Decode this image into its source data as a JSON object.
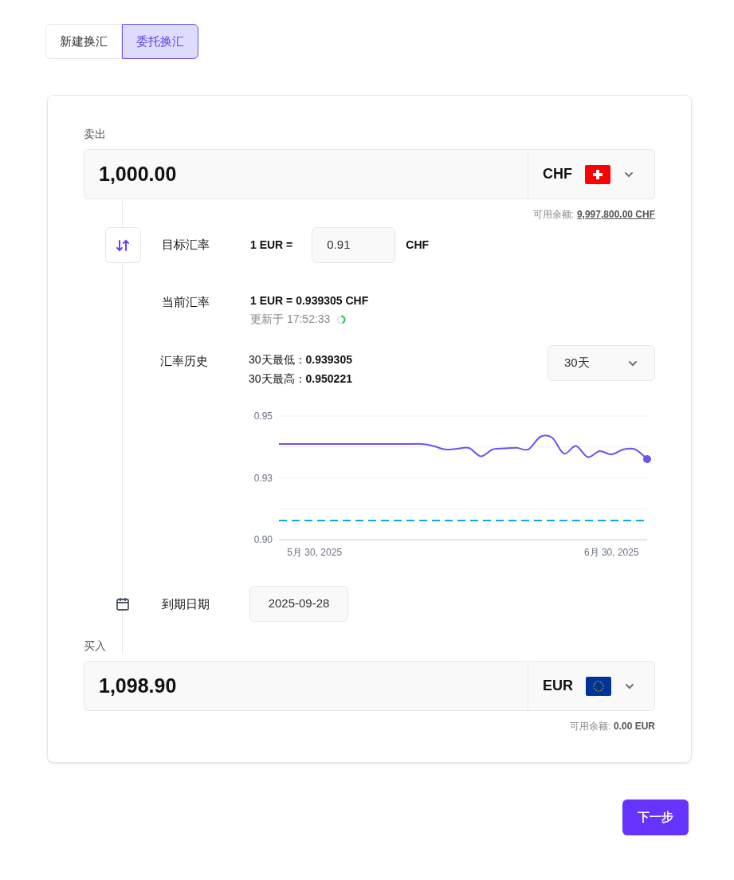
{
  "tabs": [
    {
      "label": "新建换汇",
      "selected": false
    },
    {
      "label": "委托换汇",
      "selected": true
    }
  ],
  "sell": {
    "label": "卖出",
    "amount": "1,000.00",
    "currency": "CHF",
    "kind": "ch",
    "balance_label": "可用余额:",
    "balance": "9,997,800.00 CHF",
    "balance_link": true
  },
  "target_rate": {
    "label": "目标汇率",
    "prefix": "1 EUR =",
    "value": "0.91",
    "suffix": "CHF"
  },
  "current_rate": {
    "label": "当前汇率",
    "rate": "1 EUR = 0.939305 CHF",
    "updated": "更新于 17:52:33"
  },
  "history": {
    "label": "汇率历史",
    "low_label": "30天最低：",
    "low": "0.939305",
    "high_label": "30天最高：",
    "high": "0.950221",
    "period": "30天",
    "chart_data": {
      "type": "line",
      "categories": [
        null,
        null,
        null,
        "5月 30, 2025",
        null,
        null,
        null,
        null,
        null,
        null,
        null,
        null,
        null,
        null,
        null,
        null,
        null,
        null,
        null,
        null,
        null,
        null,
        null,
        null,
        null,
        null,
        null,
        null,
        "6月 30, 2025",
        null,
        null,
        null
      ],
      "ylim": [
        0.9,
        0.95
      ],
      "yticks": [
        {
          "value": 0.95,
          "label": "0.95"
        },
        {
          "value": 0.925,
          "label": "0.93"
        },
        {
          "value": 0.9,
          "label": "0.90"
        }
      ],
      "series": [
        {
          "color": "#6e52f0",
          "values": [
            0.9387,
            0.9387,
            0.9387,
            0.9387,
            0.9387,
            0.9387,
            0.9387,
            0.9387,
            0.9387,
            0.9387,
            0.9387,
            0.9387,
            0.9387,
            0.9379,
            0.9365,
            0.9368,
            0.9371,
            0.9337,
            0.9365,
            0.9369,
            0.9372,
            0.9365,
            0.9416,
            0.9413,
            0.9348,
            0.9379,
            0.9334,
            0.9358,
            0.9345,
            0.9365,
            0.9365,
            0.9326
          ]
        },
        {
          "color": "#0ea5e9",
          "line_style": "dashed",
          "values": [
            0.9077,
            0.9077,
            0.9077,
            0.9077,
            0.9077,
            0.9077,
            0.9077,
            0.9077,
            0.9077,
            0.9077,
            0.9077,
            0.9077,
            0.9077,
            0.9077,
            0.9077,
            0.9077,
            0.9077,
            0.9077,
            0.9077,
            0.9077,
            0.9077,
            0.9077,
            0.9077,
            0.9077,
            0.9077,
            0.9077,
            0.9077,
            0.9077,
            0.9077,
            0.9077,
            0.9077,
            0.9077
          ]
        }
      ]
    }
  },
  "expiry": {
    "label": "到期日期",
    "value": "2025-09-28"
  },
  "buy": {
    "label": "买入",
    "amount": "1,098.90",
    "currency": "EUR",
    "kind": "eu",
    "balance_label": "可用余额:",
    "balance": "0.00 EUR",
    "balance_link": false
  },
  "next_button": "下一步"
}
